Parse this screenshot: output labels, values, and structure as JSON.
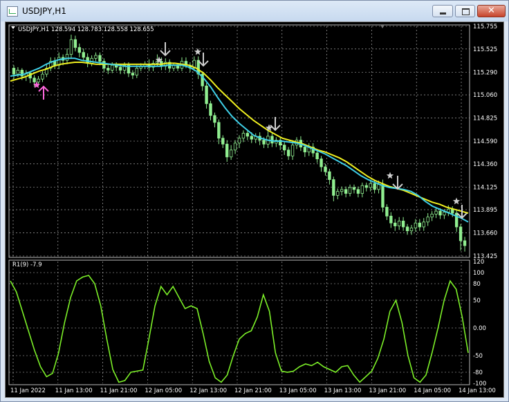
{
  "window": {
    "title": "USDJPY,H1",
    "minimize_label": "",
    "maximize_label": "",
    "close_label": "✕"
  },
  "chart": {
    "header": "USDJPY,H1  128.594 128.783 128.558 128.655",
    "indicator_label": "R1(9) -7.9",
    "price_ticks": [
      "115.755",
      "115.525",
      "115.290",
      "115.060",
      "114.825",
      "114.590",
      "114.360",
      "114.125",
      "113.895",
      "113.660",
      "113.425"
    ],
    "price_tick_values": [
      115.755,
      115.525,
      115.29,
      115.06,
      114.825,
      114.59,
      114.36,
      114.125,
      113.895,
      113.66,
      113.425
    ],
    "osc_ticks": [
      "120",
      "100",
      "80",
      "50",
      "0.00",
      "-50",
      "-80",
      "-100"
    ],
    "osc_tick_values": [
      120,
      100,
      80,
      50,
      0,
      -50,
      -80,
      -100
    ],
    "time_ticks": [
      "11 Jan 2022",
      "11 Jan 13:00",
      "11 Jan 21:00",
      "12 Jan 05:00",
      "12 Jan 13:00",
      "12 Jan 21:00",
      "13 Jan 05:00",
      "13 Jan 13:00",
      "13 Jan 21:00",
      "14 Jan 05:00",
      "14 Jan 13:00"
    ],
    "colors": {
      "background": "#000000",
      "grid": "#c8c8c8",
      "candle": "#90ee90",
      "ma_fast": "#3fd0e8",
      "ma_slow": "#f0f020",
      "oscillator": "#7cf028",
      "arrow_up": "#ff66dd",
      "arrow_down": "#d0d0d0"
    }
  },
  "chart_data": {
    "type": "candlestick",
    "price_range": [
      113.425,
      115.755
    ],
    "oscillator_range": [
      -100,
      120
    ],
    "candles": [
      [
        115.33,
        115.27,
        115.36,
        115.22
      ],
      [
        115.27,
        115.31,
        115.34,
        115.24
      ],
      [
        115.31,
        115.25,
        115.33,
        115.21
      ],
      [
        115.25,
        115.28,
        115.31,
        115.2
      ],
      [
        115.28,
        115.23,
        115.3,
        115.18
      ],
      [
        115.23,
        115.19,
        115.26,
        115.14
      ],
      [
        115.19,
        115.22,
        115.25,
        115.15
      ],
      [
        115.22,
        115.27,
        115.3,
        115.19
      ],
      [
        115.27,
        115.33,
        115.37,
        115.24
      ],
      [
        115.33,
        115.4,
        115.44,
        115.3
      ],
      [
        115.4,
        115.36,
        115.44,
        115.32
      ],
      [
        115.36,
        115.44,
        115.49,
        115.32
      ],
      [
        115.44,
        115.41,
        115.47,
        115.36
      ],
      [
        115.41,
        115.47,
        115.53,
        115.37
      ],
      [
        115.47,
        115.62,
        115.67,
        115.43
      ],
      [
        115.62,
        115.54,
        115.66,
        115.5
      ],
      [
        115.54,
        115.49,
        115.58,
        115.44
      ],
      [
        115.49,
        115.44,
        115.53,
        115.4
      ],
      [
        115.44,
        115.38,
        115.48,
        115.34
      ],
      [
        115.38,
        115.43,
        115.46,
        115.35
      ],
      [
        115.43,
        115.46,
        115.49,
        115.4
      ],
      [
        115.46,
        115.4,
        115.49,
        115.36
      ],
      [
        115.4,
        115.33,
        115.43,
        115.29
      ],
      [
        115.33,
        115.31,
        115.36,
        115.27
      ],
      [
        115.31,
        115.36,
        115.39,
        115.28
      ],
      [
        115.36,
        115.34,
        115.39,
        115.3
      ],
      [
        115.34,
        115.31,
        115.37,
        115.27
      ],
      [
        115.31,
        115.36,
        115.39,
        115.27
      ],
      [
        115.36,
        115.28,
        115.39,
        115.24
      ],
      [
        115.28,
        115.26,
        115.31,
        115.22
      ],
      [
        115.26,
        115.33,
        115.36,
        115.23
      ],
      [
        115.33,
        115.35,
        115.38,
        115.3
      ],
      [
        115.35,
        115.37,
        115.4,
        115.32
      ],
      [
        115.37,
        115.34,
        115.42,
        115.3
      ],
      [
        115.34,
        115.38,
        115.41,
        115.3
      ],
      [
        115.38,
        115.4,
        115.47,
        115.35
      ],
      [
        115.4,
        115.35,
        115.44,
        115.31
      ],
      [
        115.35,
        115.39,
        115.43,
        115.31
      ],
      [
        115.39,
        115.33,
        115.42,
        115.29
      ],
      [
        115.33,
        115.36,
        115.38,
        115.3
      ],
      [
        115.36,
        115.33,
        115.38,
        115.3
      ],
      [
        115.33,
        115.4,
        115.44,
        115.3
      ],
      [
        115.4,
        115.36,
        115.44,
        115.33
      ],
      [
        115.36,
        115.33,
        115.39,
        115.29
      ],
      [
        115.33,
        115.41,
        115.45,
        115.3
      ],
      [
        115.41,
        115.27,
        115.45,
        115.22
      ],
      [
        115.27,
        115.15,
        115.3,
        115.1
      ],
      [
        115.15,
        114.97,
        115.18,
        114.92
      ],
      [
        114.97,
        114.85,
        115,
        114.8
      ],
      [
        114.85,
        114.78,
        114.88,
        114.73
      ],
      [
        114.78,
        114.62,
        114.81,
        114.56
      ],
      [
        114.62,
        114.56,
        114.65,
        114.52
      ],
      [
        114.56,
        114.43,
        114.6,
        114.38
      ],
      [
        114.43,
        114.5,
        114.55,
        114.4
      ],
      [
        114.5,
        114.57,
        114.6,
        114.46
      ],
      [
        114.57,
        114.62,
        114.65,
        114.52
      ],
      [
        114.62,
        114.67,
        114.7,
        114.58
      ],
      [
        114.67,
        114.64,
        114.7,
        114.6
      ],
      [
        114.64,
        114.61,
        114.68,
        114.57
      ],
      [
        114.61,
        114.64,
        114.67,
        114.57
      ],
      [
        114.64,
        114.6,
        114.68,
        114.55
      ],
      [
        114.6,
        114.56,
        114.63,
        114.52
      ],
      [
        114.56,
        114.64,
        114.7,
        114.52
      ],
      [
        114.64,
        114.57,
        114.68,
        114.53
      ],
      [
        114.57,
        114.6,
        114.63,
        114.53
      ],
      [
        114.6,
        114.55,
        114.63,
        114.5
      ],
      [
        114.55,
        114.5,
        114.58,
        114.45
      ],
      [
        114.5,
        114.44,
        114.53,
        114.4
      ],
      [
        114.44,
        114.55,
        114.6,
        114.4
      ],
      [
        114.55,
        114.6,
        114.63,
        114.51
      ],
      [
        114.6,
        114.53,
        114.64,
        114.49
      ],
      [
        114.53,
        114.48,
        114.56,
        114.43
      ],
      [
        114.48,
        114.53,
        114.57,
        114.44
      ],
      [
        114.53,
        114.47,
        114.57,
        114.43
      ],
      [
        114.47,
        114.41,
        114.5,
        114.37
      ],
      [
        114.41,
        114.33,
        114.44,
        114.28
      ],
      [
        114.33,
        114.28,
        114.36,
        114.24
      ],
      [
        114.28,
        114.2,
        114.31,
        114.15
      ],
      [
        114.2,
        114.04,
        114.23,
        113.98
      ],
      [
        114.04,
        114.08,
        114.11,
        114
      ],
      [
        114.08,
        114.1,
        114.13,
        114.04
      ],
      [
        114.1,
        114.06,
        114.13,
        114.02
      ],
      [
        114.06,
        114.12,
        114.15,
        114.03
      ],
      [
        114.12,
        114.1,
        114.15,
        114.06
      ],
      [
        114.1,
        114.06,
        114.13,
        114.02
      ],
      [
        114.06,
        114.14,
        114.17,
        114.02
      ],
      [
        114.14,
        114.12,
        114.17,
        114.08
      ],
      [
        114.12,
        114.16,
        114.2,
        114.08
      ],
      [
        114.16,
        114.1,
        114.19,
        114.06
      ],
      [
        114.1,
        114.15,
        114.19,
        114.06
      ],
      [
        114.15,
        113.92,
        114.2,
        113.87
      ],
      [
        113.92,
        113.83,
        113.95,
        113.79
      ],
      [
        113.83,
        113.76,
        113.87,
        113.71
      ],
      [
        113.76,
        113.73,
        113.8,
        113.68
      ],
      [
        113.73,
        113.78,
        113.82,
        113.69
      ],
      [
        113.78,
        113.72,
        113.82,
        113.68
      ],
      [
        113.72,
        113.68,
        113.75,
        113.64
      ],
      [
        113.68,
        113.71,
        113.74,
        113.64
      ],
      [
        113.71,
        113.76,
        113.8,
        113.67
      ],
      [
        113.76,
        113.72,
        113.8,
        113.68
      ],
      [
        113.72,
        113.77,
        113.81,
        113.68
      ],
      [
        113.77,
        113.82,
        113.86,
        113.73
      ],
      [
        113.82,
        113.85,
        113.88,
        113.78
      ],
      [
        113.85,
        113.88,
        113.91,
        113.81
      ],
      [
        113.88,
        113.84,
        113.91,
        113.8
      ],
      [
        113.84,
        113.87,
        113.9,
        113.8
      ],
      [
        113.87,
        113.9,
        113.94,
        113.83
      ],
      [
        113.9,
        113.86,
        113.93,
        113.82
      ],
      [
        113.86,
        113.72,
        113.9,
        113.67
      ],
      [
        113.72,
        113.58,
        113.75,
        113.48
      ],
      [
        113.58,
        113.53,
        113.62,
        113.47
      ]
    ],
    "ma_fast": [
      115.25,
      115.26,
      115.27,
      115.3,
      115.33,
      115.37,
      115.4,
      115.42,
      115.43,
      115.43,
      115.41,
      115.4,
      115.39,
      115.38,
      115.37,
      115.36,
      115.35,
      115.35,
      115.35,
      115.35,
      115.35,
      115.35,
      115.36,
      115.36,
      115.36,
      115.34,
      115.3,
      115.23,
      115.14,
      115.03,
      114.93,
      114.84,
      114.77,
      114.71,
      114.65,
      114.62,
      114.6,
      114.59,
      114.59,
      114.58,
      114.57,
      114.55,
      114.52,
      114.49,
      114.46,
      114.42,
      114.38,
      114.34,
      114.29,
      114.24,
      114.2,
      114.17,
      114.14,
      114.12,
      114.11,
      114.1,
      114.08,
      114.04,
      113.98,
      113.93,
      113.9,
      113.87,
      113.84,
      113.81,
      113.77
    ],
    "ma_slow": [
      115.2,
      115.22,
      115.24,
      115.27,
      115.3,
      115.32,
      115.35,
      115.37,
      115.38,
      115.39,
      115.39,
      115.38,
      115.37,
      115.37,
      115.37,
      115.37,
      115.37,
      115.37,
      115.37,
      115.37,
      115.37,
      115.37,
      115.38,
      115.38,
      115.37,
      115.36,
      115.33,
      115.28,
      115.21,
      115.13,
      115.06,
      114.99,
      114.92,
      114.86,
      114.8,
      114.75,
      114.7,
      114.66,
      114.62,
      114.6,
      114.58,
      114.56,
      114.53,
      114.5,
      114.48,
      114.45,
      114.42,
      114.38,
      114.33,
      114.28,
      114.23,
      114.19,
      114.16,
      114.13,
      114.11,
      114.09,
      114.06,
      114.03,
      114,
      113.97,
      113.95,
      113.92,
      113.9,
      113.88,
      113.86
    ],
    "oscillator": [
      85,
      65,
      30,
      -5,
      -40,
      -70,
      -88,
      -82,
      -45,
      10,
      55,
      85,
      92,
      95,
      80,
      40,
      -20,
      -75,
      -98,
      -95,
      -80,
      -78,
      -76,
      -20,
      40,
      75,
      60,
      75,
      55,
      35,
      40,
      35,
      -10,
      -60,
      -90,
      -98,
      -85,
      -50,
      -20,
      -10,
      -5,
      20,
      60,
      30,
      -45,
      -78,
      -80,
      -78,
      -70,
      -65,
      -68,
      -62,
      -70,
      -75,
      -80,
      -70,
      -68,
      -85,
      -98,
      -88,
      -78,
      -55,
      -20,
      30,
      50,
      10,
      -50,
      -90,
      -98,
      -85,
      -45,
      0,
      50,
      85,
      70,
      20,
      -45
    ]
  }
}
